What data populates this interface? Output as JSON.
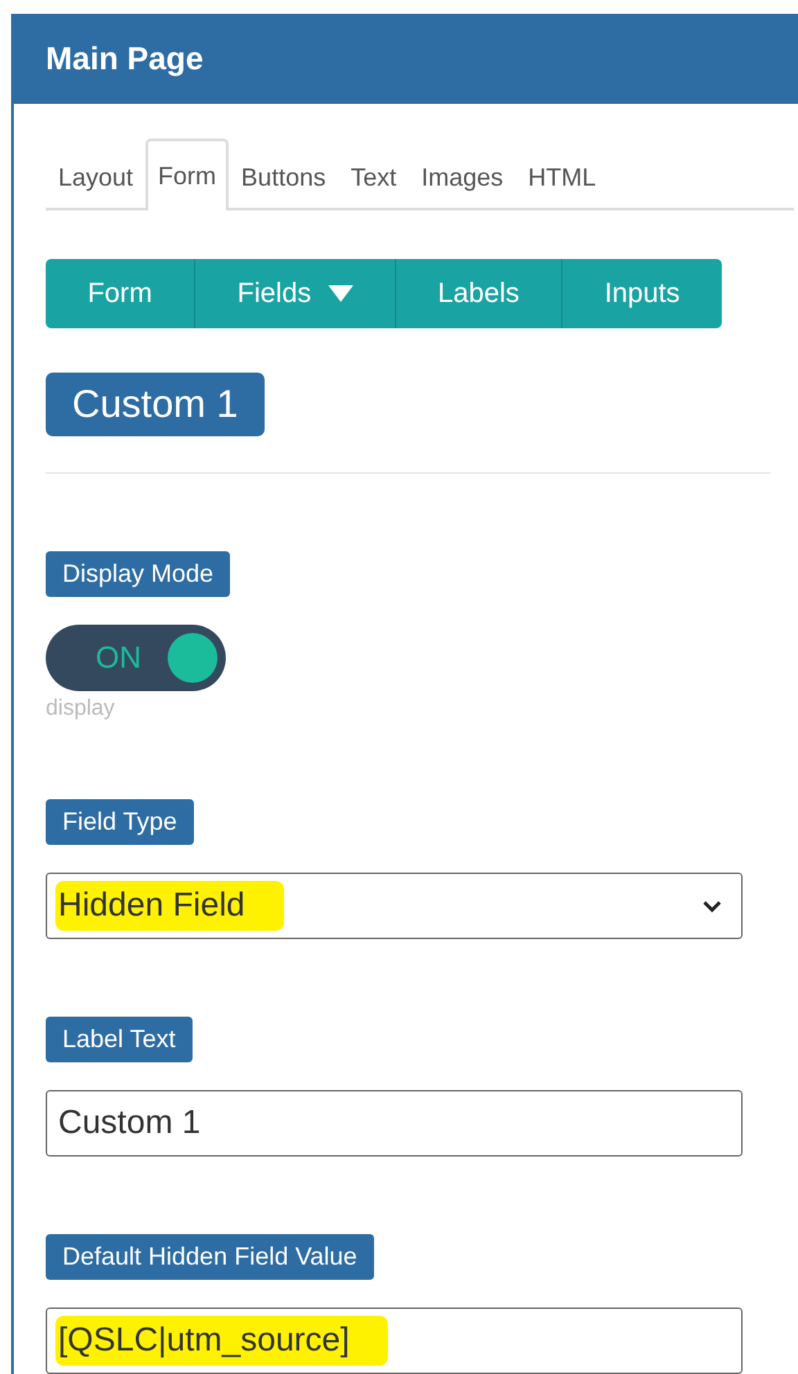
{
  "header": {
    "title": "Main Page"
  },
  "tabs": [
    {
      "label": "Layout",
      "selected": false
    },
    {
      "label": "Form",
      "selected": true
    },
    {
      "label": "Buttons",
      "selected": false
    },
    {
      "label": "Text",
      "selected": false
    },
    {
      "label": "Images",
      "selected": false
    },
    {
      "label": "HTML",
      "selected": false
    }
  ],
  "subnav": [
    {
      "label": "Form",
      "dropdown": false
    },
    {
      "label": "Fields",
      "dropdown": true
    },
    {
      "label": "Labels",
      "dropdown": false
    },
    {
      "label": "Inputs",
      "dropdown": false
    }
  ],
  "section_title": "Custom 1",
  "fields": [
    {
      "kind": "toggle",
      "label": "Display Mode",
      "on": true,
      "state_text": "ON",
      "hint": "display"
    },
    {
      "kind": "select",
      "label": "Field Type",
      "value": "Hidden Field",
      "highlighted": true
    },
    {
      "kind": "text",
      "label": "Label Text",
      "value": "Custom 1",
      "highlighted": false
    },
    {
      "kind": "text",
      "label": "Default Hidden Field Value",
      "value": "[QSLC|utm_source]",
      "highlighted": true
    }
  ]
}
